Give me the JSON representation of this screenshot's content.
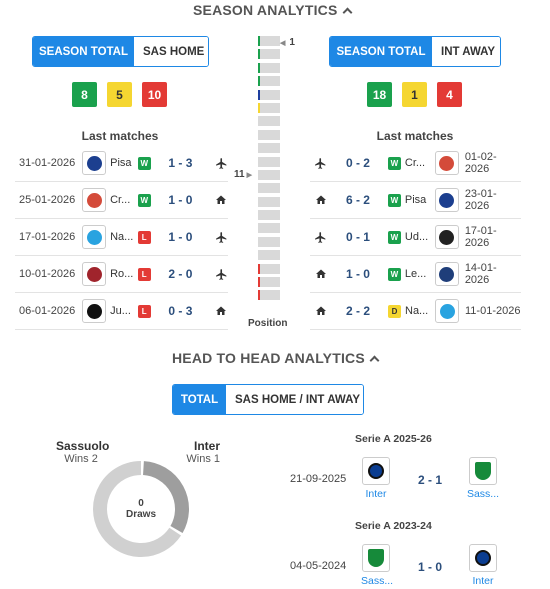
{
  "season": {
    "title": "SEASON ANALYTICS",
    "left": {
      "toggle": [
        "SEASON TOTAL",
        "SAS HOME"
      ],
      "wins": "8",
      "draws": "5",
      "losses": "10",
      "last_matches_title": "Last matches",
      "matches": [
        {
          "date": "31-01-2026",
          "team": "Pisa",
          "result": "W",
          "score": "1 - 3",
          "venue": "away",
          "crest": "#1c3f8f"
        },
        {
          "date": "25-01-2026",
          "team": "Cr...",
          "result": "W",
          "score": "1 - 0",
          "venue": "home",
          "crest": "#d44b3a"
        },
        {
          "date": "17-01-2026",
          "team": "Na...",
          "result": "L",
          "score": "1 - 0",
          "venue": "away",
          "crest": "#29a3e0"
        },
        {
          "date": "10-01-2026",
          "team": "Ro...",
          "result": "L",
          "score": "2 - 0",
          "venue": "away",
          "crest": "#a0242c"
        },
        {
          "date": "06-01-2026",
          "team": "Ju...",
          "result": "L",
          "score": "0 - 3",
          "venue": "home",
          "crest": "#111111"
        }
      ]
    },
    "right": {
      "toggle": [
        "SEASON TOTAL",
        "INT AWAY"
      ],
      "wins": "18",
      "draws": "1",
      "losses": "4",
      "last_matches_title": "Last matches",
      "matches": [
        {
          "date": "01-02-2026",
          "team": "Cr...",
          "result": "W",
          "score": "0 - 2",
          "venue": "away",
          "crest": "#d44b3a"
        },
        {
          "date": "23-01-2026",
          "team": "Pisa",
          "result": "W",
          "score": "6 - 2",
          "venue": "home",
          "crest": "#1c3f8f"
        },
        {
          "date": "17-01-2026",
          "team": "Ud...",
          "result": "W",
          "score": "0 - 1",
          "venue": "away",
          "crest": "#222222"
        },
        {
          "date": "14-01-2026",
          "team": "Le...",
          "result": "W",
          "score": "1 - 0",
          "venue": "home",
          "crest": "#1f3e7a"
        },
        {
          "date": "11-01-2026",
          "team": "Na...",
          "result": "D",
          "score": "2 - 2",
          "venue": "home",
          "crest": "#29a3e0"
        }
      ]
    },
    "position": {
      "label": "Position",
      "top_marker": "1",
      "mid_marker": "11",
      "cells": 20
    },
    "colors": {
      "accent": "#1e88e5",
      "win": "#1aa14d",
      "draw": "#f5d631",
      "loss": "#e33a35"
    }
  },
  "h2h": {
    "title": "HEAD TO HEAD ANALYTICS",
    "toggle": [
      "TOTAL",
      "SAS HOME / INT AWAY"
    ],
    "home_team": "Sassuolo",
    "home_wins": "Wins 2",
    "away_team": "Inter",
    "away_wins": "Wins 1",
    "draws_count": "0",
    "draws_label": "Draws",
    "donut": {
      "home": 2,
      "draws": 0,
      "away": 1
    },
    "matches": [
      {
        "competition": "Serie A 2025-26",
        "date": "21-09-2025",
        "home": "Inter",
        "score": "2 - 1",
        "away": "Sass..."
      },
      {
        "competition": "Serie A 2023-24",
        "date": "04-05-2024",
        "home": "Sass...",
        "score": "1 - 0",
        "away": "Inter"
      }
    ]
  }
}
